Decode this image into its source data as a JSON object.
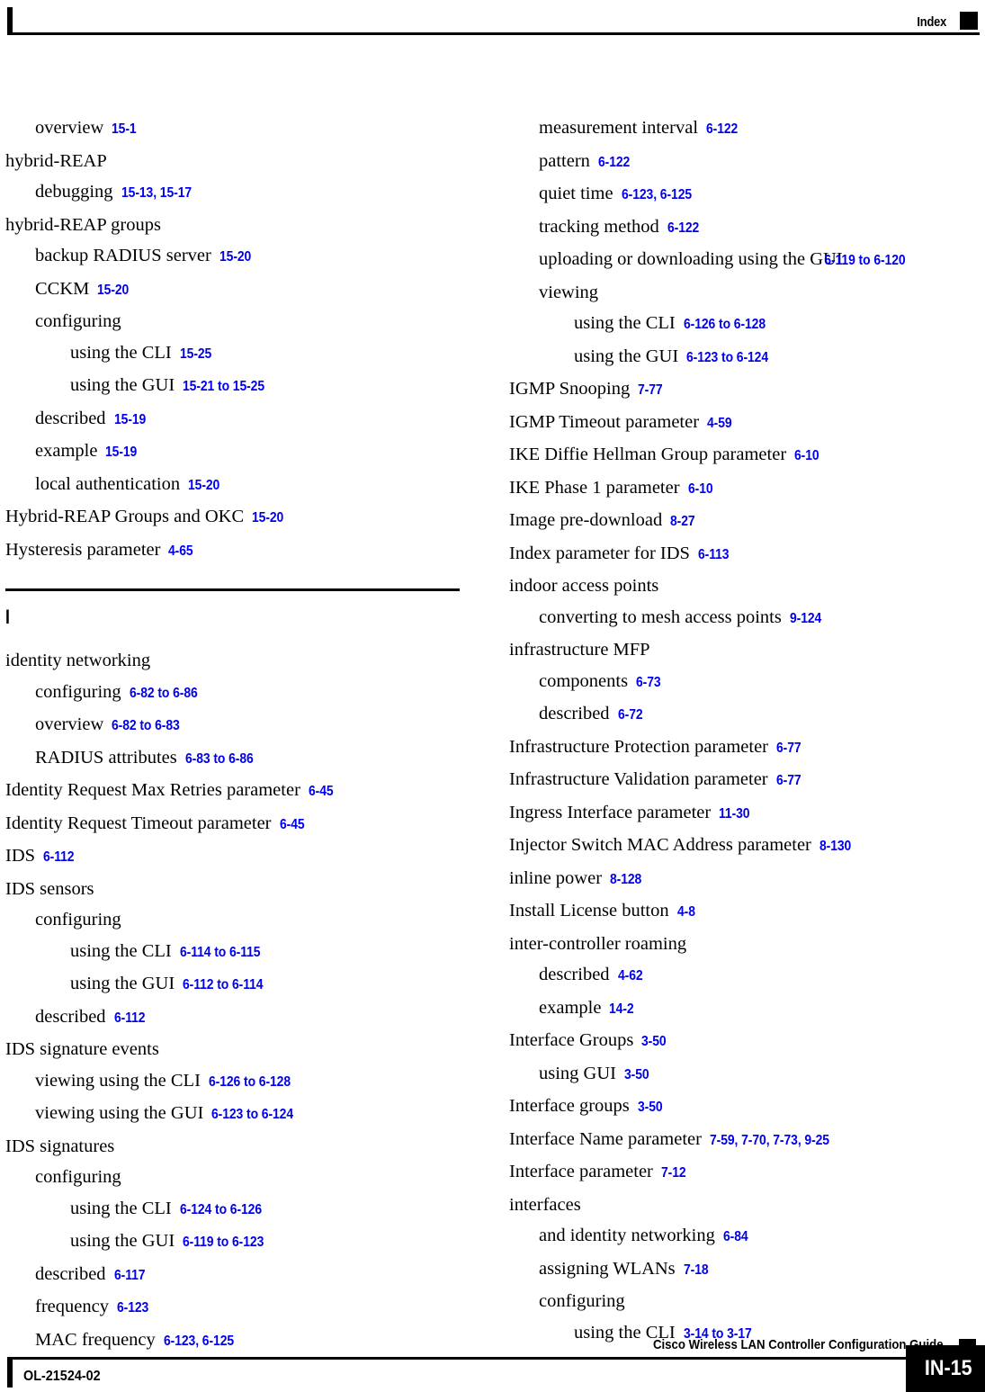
{
  "header": {
    "label": "Index",
    "marker_color": "#000000"
  },
  "footer": {
    "guide_title": "Cisco Wireless LAN Controller Configuration Guide",
    "doc_id": "OL-21524-02",
    "page_number": "IN-15"
  },
  "style": {
    "page_ref_color": "#0000f0",
    "text_color": "#000000"
  },
  "columns": {
    "left": {
      "blocks": [
        {
          "type": "entries",
          "entries": [
            {
              "level": 1,
              "term": "overview",
              "pages": "15-1"
            },
            {
              "level": 0,
              "term": "hybrid-REAP",
              "pages": ""
            },
            {
              "level": 1,
              "term": "debugging",
              "pages": "15-13, 15-17"
            },
            {
              "level": 0,
              "term": "hybrid-REAP groups",
              "pages": ""
            },
            {
              "level": 1,
              "term": "backup RADIUS server",
              "pages": "15-20"
            },
            {
              "level": 1,
              "term": "CCKM",
              "pages": "15-20"
            },
            {
              "level": 1,
              "term": "configuring",
              "pages": ""
            },
            {
              "level": 2,
              "term": "using the CLI",
              "pages": "15-25"
            },
            {
              "level": 2,
              "term": "using the GUI",
              "pages": "15-21 to 15-25"
            },
            {
              "level": 1,
              "term": "described",
              "pages": "15-19"
            },
            {
              "level": 1,
              "term": "example",
              "pages": "15-19"
            },
            {
              "level": 1,
              "term": "local authentication",
              "pages": "15-20"
            },
            {
              "level": 0,
              "term": "Hybrid-REAP Groups and OKC",
              "pages": "15-20"
            },
            {
              "level": 0,
              "term": "Hysteresis parameter",
              "pages": "4-65"
            }
          ]
        },
        {
          "type": "section",
          "letter": "I"
        },
        {
          "type": "entries",
          "entries": [
            {
              "level": 0,
              "term": "identity networking",
              "pages": ""
            },
            {
              "level": 1,
              "term": "configuring",
              "pages": "6-82 to 6-86"
            },
            {
              "level": 1,
              "term": "overview",
              "pages": "6-82 to 6-83"
            },
            {
              "level": 1,
              "term": "RADIUS attributes",
              "pages": "6-83 to 6-86"
            },
            {
              "level": 0,
              "term": "Identity Request Max Retries parameter",
              "pages": "6-45"
            },
            {
              "level": 0,
              "term": "Identity Request Timeout parameter",
              "pages": "6-45"
            },
            {
              "level": 0,
              "term": "IDS",
              "pages": "6-112"
            },
            {
              "level": 0,
              "term": "IDS sensors",
              "pages": ""
            },
            {
              "level": 1,
              "term": "configuring",
              "pages": ""
            },
            {
              "level": 2,
              "term": "using the CLI",
              "pages": "6-114 to 6-115"
            },
            {
              "level": 2,
              "term": "using the GUI",
              "pages": "6-112 to 6-114"
            },
            {
              "level": 1,
              "term": "described",
              "pages": "6-112"
            },
            {
              "level": 0,
              "term": "IDS signature events",
              "pages": ""
            },
            {
              "level": 1,
              "term": "viewing using the CLI",
              "pages": "6-126 to 6-128"
            },
            {
              "level": 1,
              "term": "viewing using the GUI",
              "pages": "6-123 to 6-124"
            },
            {
              "level": 0,
              "term": "IDS signatures",
              "pages": ""
            },
            {
              "level": 1,
              "term": "configuring",
              "pages": ""
            },
            {
              "level": 2,
              "term": "using the CLI",
              "pages": "6-124 to 6-126"
            },
            {
              "level": 2,
              "term": "using the GUI",
              "pages": "6-119 to 6-123"
            },
            {
              "level": 1,
              "term": "described",
              "pages": "6-117"
            },
            {
              "level": 1,
              "term": "frequency",
              "pages": "6-123"
            },
            {
              "level": 1,
              "term": "MAC frequency",
              "pages": "6-123, 6-125"
            }
          ]
        }
      ]
    },
    "right": {
      "blocks": [
        {
          "type": "entries",
          "entries": [
            {
              "level": 1,
              "term": "measurement interval",
              "pages": "6-122"
            },
            {
              "level": 1,
              "term": "pattern",
              "pages": "6-122"
            },
            {
              "level": 1,
              "term": "quiet time",
              "pages": "6-123, 6-125"
            },
            {
              "level": 1,
              "term": "tracking method",
              "pages": "6-122"
            },
            {
              "level": 1,
              "term": "uploading or downloading using the GUI",
              "pages": "6-119 to 6-120",
              "wrap": true
            },
            {
              "level": 1,
              "term": "viewing",
              "pages": ""
            },
            {
              "level": 2,
              "term": "using the CLI",
              "pages": "6-126 to 6-128"
            },
            {
              "level": 2,
              "term": "using the GUI",
              "pages": "6-123 to 6-124"
            },
            {
              "level": 0,
              "term": "IGMP Snooping",
              "pages": "7-77"
            },
            {
              "level": 0,
              "term": "IGMP Timeout parameter",
              "pages": "4-59"
            },
            {
              "level": 0,
              "term": "IKE Diffie Hellman Group parameter",
              "pages": "6-10"
            },
            {
              "level": 0,
              "term": "IKE Phase 1 parameter",
              "pages": "6-10"
            },
            {
              "level": 0,
              "term": "Image pre-download",
              "pages": "8-27"
            },
            {
              "level": 0,
              "term": "Index parameter for IDS",
              "pages": "6-113"
            },
            {
              "level": 0,
              "term": "indoor access points",
              "pages": ""
            },
            {
              "level": 1,
              "term": "converting to mesh access points",
              "pages": "9-124"
            },
            {
              "level": 0,
              "term": "infrastructure MFP",
              "pages": ""
            },
            {
              "level": 1,
              "term": "components",
              "pages": "6-73"
            },
            {
              "level": 1,
              "term": "described",
              "pages": "6-72"
            },
            {
              "level": 0,
              "term": "Infrastructure Protection parameter",
              "pages": "6-77"
            },
            {
              "level": 0,
              "term": "Infrastructure Validation parameter",
              "pages": "6-77"
            },
            {
              "level": 0,
              "term": "Ingress Interface parameter",
              "pages": "11-30"
            },
            {
              "level": 0,
              "term": "Injector Switch MAC Address parameter",
              "pages": "8-130"
            },
            {
              "level": 0,
              "term": "inline power",
              "pages": "8-128"
            },
            {
              "level": 0,
              "term": "Install License button",
              "pages": "4-8"
            },
            {
              "level": 0,
              "term": "inter-controller roaming",
              "pages": ""
            },
            {
              "level": 1,
              "term": "described",
              "pages": "4-62"
            },
            {
              "level": 1,
              "term": "example",
              "pages": "14-2"
            },
            {
              "level": 0,
              "term": "Interface Groups",
              "pages": "3-50"
            },
            {
              "level": 1,
              "term": "using GUI",
              "pages": "3-50"
            },
            {
              "level": 0,
              "term": "Interface groups",
              "pages": "3-50"
            },
            {
              "level": 0,
              "term": "Interface Name parameter",
              "pages": "7-59, 7-70, 7-73, 9-25"
            },
            {
              "level": 0,
              "term": "Interface parameter",
              "pages": "7-12"
            },
            {
              "level": 0,
              "term": "interfaces",
              "pages": ""
            },
            {
              "level": 1,
              "term": "and identity networking",
              "pages": "6-84"
            },
            {
              "level": 1,
              "term": "assigning WLANs",
              "pages": "7-18"
            },
            {
              "level": 1,
              "term": "configuring",
              "pages": ""
            },
            {
              "level": 2,
              "term": "using the CLI",
              "pages": "3-14 to 3-17"
            }
          ]
        }
      ]
    }
  }
}
